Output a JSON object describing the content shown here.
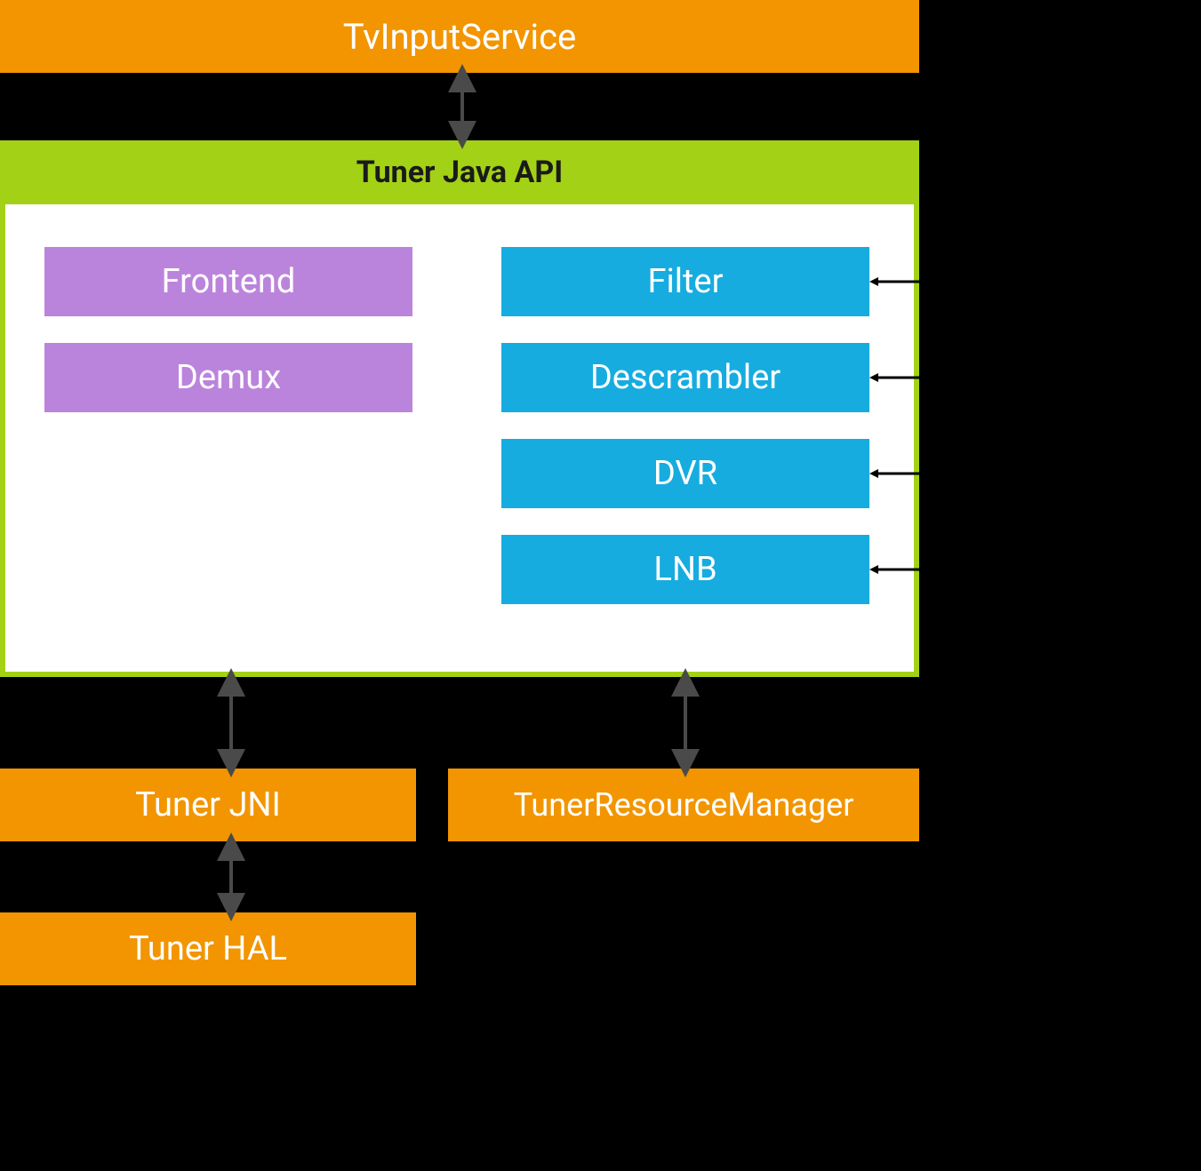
{
  "top": {
    "title": "TvInputService"
  },
  "api": {
    "header": "Tuner Java API",
    "left_components": [
      {
        "label": "Frontend"
      },
      {
        "label": "Demux"
      }
    ],
    "right_components": [
      {
        "label": "Filter"
      },
      {
        "label": "Descrambler"
      },
      {
        "label": "DVR"
      },
      {
        "label": "LNB"
      }
    ]
  },
  "bottom": {
    "jni": "Tuner JNI",
    "resource_manager": "TunerResourceManager",
    "hal": "Tuner HAL"
  },
  "colors": {
    "orange": "#f29500",
    "green": "#a3d116",
    "purple": "#bb84dc",
    "blue": "#16ace0",
    "arrow": "#4a4a4a"
  }
}
